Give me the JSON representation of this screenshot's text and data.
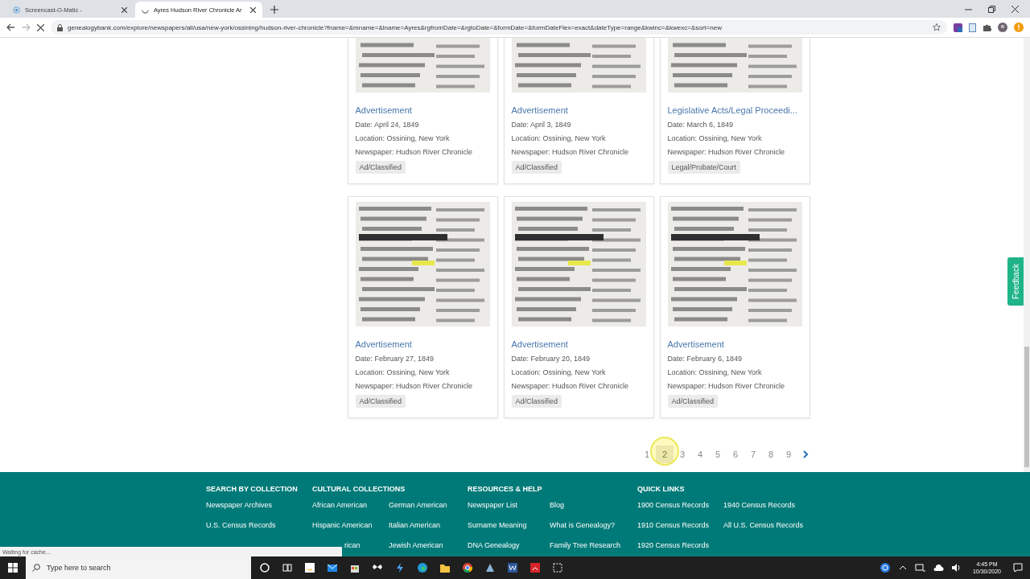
{
  "browser": {
    "tabs": [
      {
        "title": "Screencast-O-Matic -",
        "kind": "record",
        "selected": false
      },
      {
        "title": "Ayres Hudson River Chronicle Ar",
        "kind": "loading",
        "selected": true
      }
    ],
    "url": "genealogybank.com/explore/newspapers/all/usa/new-york/ossining/hudson-river-chronicle?fname=&mname=&lname=Ayres&rgfromDate=&rgtoDate=&formDate=&formDateFlex=exact&dateType=range&kwinc=&kwexc=&sort=new"
  },
  "results": [
    {
      "title": "Advertisement",
      "date": "Date: April 24, 1849",
      "location": "Location: Ossining, New York",
      "newspaper": "Newspaper: Hudson River Chronicle",
      "tag": "Ad/Classified",
      "kind": "picture"
    },
    {
      "title": "Advertisement",
      "date": "Date: April 3, 1849",
      "location": "Location: Ossining, New York",
      "newspaper": "Newspaper: Hudson River Chronicle",
      "tag": "Ad/Classified",
      "kind": "picture"
    },
    {
      "title": "Legislative Acts/Legal Proceedi...",
      "date": "Date: March 6, 1849",
      "location": "Location: Ossining, New York",
      "newspaper": "Newspaper: Hudson River Chronicle",
      "tag": "Legal/Probate/Court",
      "kind": "picture"
    },
    {
      "title": "Advertisement",
      "date": "Date: February 27, 1849",
      "location": "Location: Ossining, New York",
      "newspaper": "Newspaper: Hudson River Chronicle",
      "tag": "Ad/Classified",
      "kind": "picture"
    },
    {
      "title": "Advertisement",
      "date": "Date: February 20, 1849",
      "location": "Location: Ossining, New York",
      "newspaper": "Newspaper: Hudson River Chronicle",
      "tag": "Ad/Classified",
      "kind": "picture"
    },
    {
      "title": "Advertisement",
      "date": "Date: February 6, 1849",
      "location": "Location: Ossining, New York",
      "newspaper": "Newspaper: Hudson River Chronicle",
      "tag": "Ad/Classified",
      "kind": "picture"
    }
  ],
  "pagination": {
    "pages": [
      {
        "label": "1",
        "selected": false
      },
      {
        "label": "2",
        "selected": true
      },
      {
        "label": "3",
        "selected": false
      },
      {
        "label": "4",
        "selected": false
      },
      {
        "label": "5",
        "selected": false
      },
      {
        "label": "6",
        "selected": false
      },
      {
        "label": "7",
        "selected": false
      },
      {
        "label": "8",
        "selected": false
      },
      {
        "label": "9",
        "selected": false
      }
    ]
  },
  "feedback_tab": "Feedback",
  "footer": {
    "sections": [
      {
        "heading": "SEARCH BY COLLECTION",
        "columns": [
          [
            "Newspaper Archives",
            "U.S. Census Records"
          ]
        ]
      },
      {
        "heading": "CULTURAL COLLECTIONS",
        "columns": [
          [
            "African American",
            "Hispanic American",
            "rican"
          ],
          [
            "German American",
            "Italian American",
            "Jewish American"
          ]
        ]
      },
      {
        "heading": "RESOURCES & HELP",
        "columns": [
          [
            "Newspaper List",
            "Surname Meaning",
            "DNA Genealogy"
          ],
          [
            "Blog",
            "What is Genealogy?",
            "Family Tree Research"
          ]
        ]
      },
      {
        "heading": "QUICK LINKS",
        "columns": [
          [
            "1900 Census Records",
            "1910 Census Records",
            "1920 Census Records"
          ],
          [
            "1940 Census Records",
            "All U.S. Census Records"
          ]
        ]
      }
    ]
  },
  "status_text": "Waiting for cache...",
  "taskbar": {
    "search_placeholder": "Type here to search",
    "time": "4:45 PM",
    "date": "10/30/2020"
  }
}
